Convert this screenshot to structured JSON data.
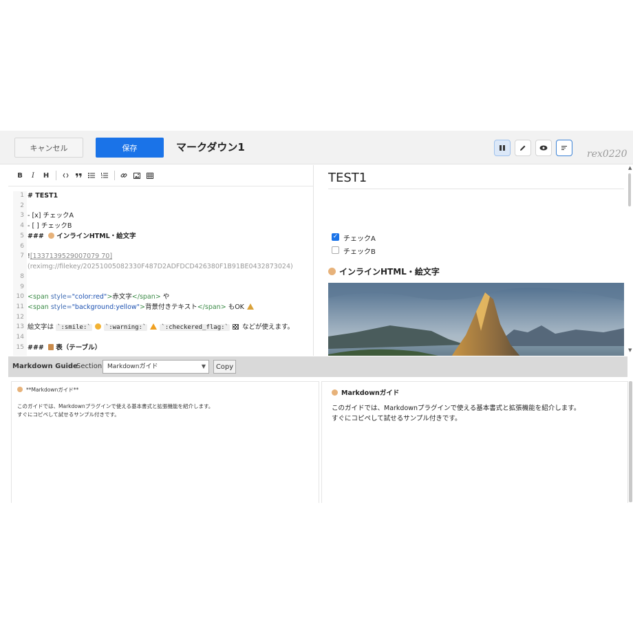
{
  "header": {
    "cancel_label": "キャンセル",
    "save_label": "保存",
    "title": "マークダウン1",
    "watermark": "rex0220"
  },
  "editor_toolbar": [
    "B",
    "I",
    "H"
  ],
  "editor": {
    "lines": [
      {
        "n": "1",
        "text": "# TEST1"
      },
      {
        "n": "2",
        "text": ""
      },
      {
        "n": "3",
        "text": "- [x] チェックA"
      },
      {
        "n": "4",
        "text": "- [ ] チェックB"
      },
      {
        "n": "5",
        "prefix": "### ",
        "rest": "インラインHTML・絵文字"
      },
      {
        "n": "6",
        "text": ""
      },
      {
        "n": "7",
        "bang": "!",
        "link": "[1337139529007079 70]",
        "path": "(reximg://filekey/20251005082330F487D2ADFDCD426380F1B91BE0432873024)"
      },
      {
        "n": "8",
        "text": ""
      },
      {
        "n": "9",
        "text": ""
      },
      {
        "n": "10",
        "open": "<span",
        "attr": " style=",
        "val": "\"color:red\"",
        "close": ">",
        "inner": "赤文字",
        "end": "</span>",
        "tail": " や"
      },
      {
        "n": "11",
        "open": "<span",
        "attr": " style=",
        "val": "\"background:yellow\"",
        "close": ">",
        "inner": "背景付きテキスト",
        "end": "</span>",
        "tail": " もOK"
      },
      {
        "n": "12",
        "text": ""
      },
      {
        "n": "13",
        "pre": "絵文字は ",
        "c1": "`:smile:`",
        "c2": "`:warning:`",
        "c3": "`:checkered_flag:`",
        "post": " などが使えます。"
      },
      {
        "n": "14",
        "text": ""
      },
      {
        "n": "15",
        "prefix": "### ",
        "rest": "表（テーブル）"
      }
    ]
  },
  "preview": {
    "h1": "TEST1",
    "checks": [
      {
        "label": "チェックA",
        "checked": true
      },
      {
        "label": "チェックB",
        "checked": false
      }
    ],
    "h3": "インラインHTML・絵文字"
  },
  "guide": {
    "title": "Markdown Guide",
    "section_label": "Section",
    "selected": "Markdownガイド",
    "copy_label": "Copy",
    "left": {
      "heading": "**Markdownガイド**",
      "line1": "このガイドでは、Markdownプラグインで使える基本書式と拡張機能を紹介します。",
      "line2": "すぐにコピペして試せるサンプル付きです。"
    },
    "right": {
      "heading": "Markdownガイド",
      "line1": "このガイドでは、Markdownプラグインで使える基本書式と拡張機能を紹介します。",
      "line2": "すぐにコピペして試せるサンプル付きです。"
    }
  },
  "colors": {
    "accent": "#1a73e8",
    "toolbar_bg": "#f2f2f2",
    "guide_bar_bg": "#d9d9d9"
  }
}
